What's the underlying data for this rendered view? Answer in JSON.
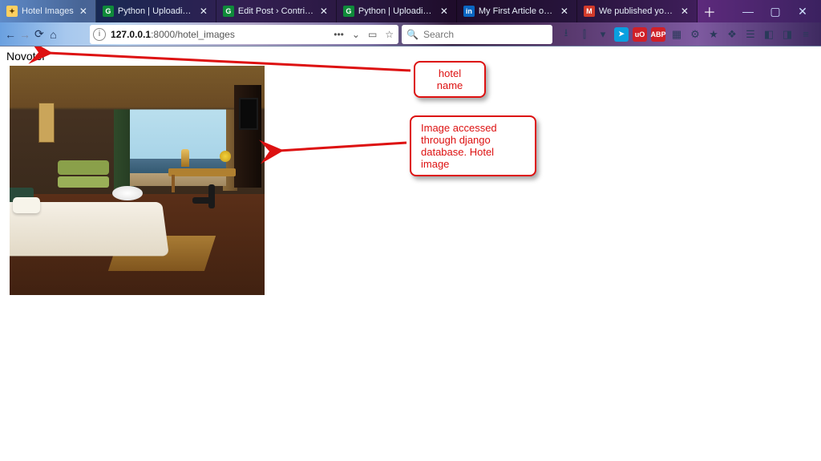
{
  "window": {
    "min": "—",
    "max": "▢",
    "close": "✕",
    "newtab": "＋"
  },
  "tabs": [
    {
      "label": "Hotel Images",
      "fav_bg": "#ffd060",
      "fav_txt": "✦",
      "fav_color": "#5a3a00",
      "close": "✕",
      "active": true
    },
    {
      "label": "Python | Uploading im…",
      "fav_bg": "#0f8a3a",
      "fav_txt": "G",
      "fav_color": "#fff",
      "close": "✕",
      "active": false
    },
    {
      "label": "Edit Post › Contribute…",
      "fav_bg": "#0f8a3a",
      "fav_txt": "G",
      "fav_color": "#fff",
      "close": "✕",
      "active": false
    },
    {
      "label": "Python | Uploading im…",
      "fav_bg": "#0f8a3a",
      "fav_txt": "G",
      "fav_color": "#fff",
      "close": "✕",
      "active": false
    },
    {
      "label": "My First Article on Gee…",
      "fav_bg": "#0a66c2",
      "fav_txt": "in",
      "fav_color": "#fff",
      "close": "✕",
      "active": false
    },
    {
      "label": "We published your art…",
      "fav_bg": "#d23a2a",
      "fav_txt": "M",
      "fav_color": "#fff",
      "close": "✕",
      "active": false
    }
  ],
  "nav": {
    "back": "←",
    "forward": "→",
    "reload": "⟳",
    "home": "⌂"
  },
  "address": {
    "host": "127.0.0.1",
    "rest": ":8000/hotel_images",
    "dots": "•••",
    "pocket": "⌄",
    "reader": "▭",
    "star": "☆"
  },
  "search": {
    "icon": "🔍",
    "placeholder": "Search"
  },
  "toolbar_icons": {
    "download": "⭳",
    "library": "⫿",
    "pocket": "▾",
    "ext1_bg": "#0aa0e0",
    "ext1_txt": "➤",
    "ext2_bg": "#d02028",
    "ext2_txt": "uO",
    "ext3_bg": "#d02028",
    "ext3_txt": "ABP",
    "qr": "▦",
    "gear": "⚙",
    "fx": "★",
    "bug": "❖",
    "save": "☰",
    "panel": "◧",
    "side": "◨",
    "menu": "≡"
  },
  "page": {
    "hotel_name": "Novotel"
  },
  "annotations": {
    "a1": "hotel name",
    "a2": "Image accessed through django database. Hotel image"
  }
}
